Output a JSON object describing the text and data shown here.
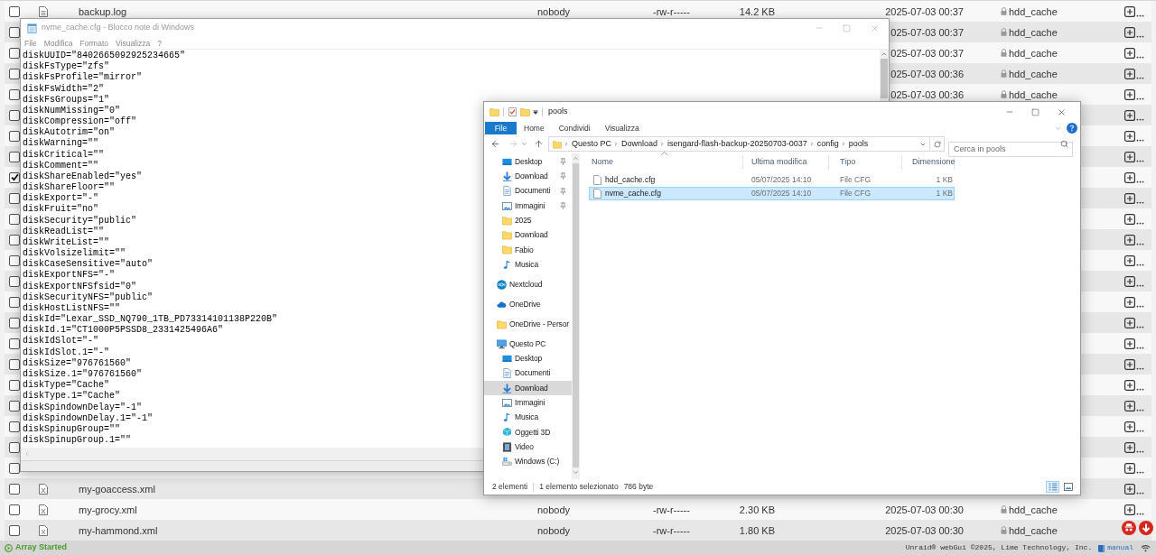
{
  "file_table": {
    "rows": [
      {
        "checked": false,
        "kind": "log",
        "name": "backup.log",
        "owner": "nobody",
        "perms": "-rw-r-----",
        "size": "14.2 KB",
        "modified": "2025-07-03 00:37",
        "share": "hdd_cache",
        "menu_icon": true
      },
      {
        "checked": false,
        "modified": "025-07-03 00:37",
        "share": "hdd_cache",
        "menu_icon": true
      },
      {
        "checked": false,
        "modified": "025-07-03 00:37",
        "share": "hdd_cache",
        "menu_icon": true
      },
      {
        "checked": false,
        "modified": "025-07-03 00:36",
        "share": "hdd_cache",
        "menu_icon": true
      },
      {
        "checked": false,
        "modified": "025-07-03 00:36",
        "share": "hdd_cache",
        "menu_icon": true
      },
      {
        "checked": false,
        "menu_icon": true
      },
      {
        "checked": false,
        "menu_icon": true
      },
      {
        "checked": false,
        "menu_icon": true
      },
      {
        "checked": true,
        "menu_icon": true
      },
      {
        "checked": false,
        "menu_icon": true
      },
      {
        "checked": false,
        "menu_icon": true
      },
      {
        "checked": false,
        "menu_icon": true
      },
      {
        "checked": false,
        "menu_icon": true
      },
      {
        "checked": false,
        "menu_icon": true
      },
      {
        "checked": false,
        "menu_icon": true
      },
      {
        "checked": false,
        "menu_icon": true
      },
      {
        "checked": false,
        "menu_icon": true
      },
      {
        "checked": false,
        "menu_icon": true
      },
      {
        "checked": false,
        "menu_icon": true
      },
      {
        "checked": false,
        "menu_icon": true
      },
      {
        "checked": false,
        "menu_icon": true
      },
      {
        "checked": false,
        "menu_icon": true
      },
      {
        "checked": false,
        "menu_icon": true
      },
      {
        "checked": false,
        "kind": "xml",
        "name": "my-goaccess.xml",
        "menu_icon": true
      },
      {
        "checked": false,
        "kind": "xml",
        "name": "my-grocy.xml",
        "owner": "nobody",
        "perms": "-rw-r-----",
        "size": "2.30 KB",
        "modified": "2025-07-03 00:30",
        "share": "hdd_cache",
        "menu_icon": true
      },
      {
        "checked": false,
        "kind": "xml",
        "name": "my-hammond.xml",
        "owner": "nobody",
        "perms": "-rw-r-----",
        "size": "1.80 KB",
        "modified": "2025-07-03 00:30",
        "share": "hdd_cache",
        "menu_icon": false
      }
    ]
  },
  "notepad": {
    "title": "nvme_cache.cfg - Blocco note di Windows",
    "menu": [
      "File",
      "Modifica",
      "Formato",
      "Visualizza",
      "?"
    ],
    "lines": [
      "diskUUID=\"8402665092925234665\"",
      "diskFsType=\"zfs\"",
      "diskFsProfile=\"mirror\"",
      "diskFsWidth=\"2\"",
      "diskFsGroups=\"1\"",
      "diskNumMissing=\"0\"",
      "diskCompression=\"off\"",
      "diskAutotrim=\"on\"",
      "diskWarning=\"\"",
      "diskCritical=\"\"",
      "diskComment=\"\"",
      "diskShareEnabled=\"yes\"",
      "diskShareFloor=\"\"",
      "diskExport=\"-\"",
      "diskFruit=\"no\"",
      "diskSecurity=\"public\"",
      "diskReadList=\"\"",
      "diskWriteList=\"\"",
      "diskVolsizelimit=\"\"",
      "diskCaseSensitive=\"auto\"",
      "diskExportNFS=\"-\"",
      "diskExportNFSfsid=\"0\"",
      "diskSecurityNFS=\"public\"",
      "diskHostListNFS=\"\"",
      "diskId=\"Lexar_SSD_NQ790_1TB_PD73314101138P220B\"",
      "diskId.1=\"CT1000P5PSSD8_2331425496A6\"",
      "diskIdSlot=\"-\"",
      "diskIdSlot.1=\"-\"",
      "diskSize=\"976761560\"",
      "diskSize.1=\"976761560\"",
      "diskType=\"Cache\"",
      "diskType.1=\"Cache\"",
      "diskSpindownDelay=\"-1\"",
      "diskSpindownDelay.1=\"-1\"",
      "diskSpinupGroup=\"\"",
      "diskSpinupGroup.1=\"\""
    ]
  },
  "explorer": {
    "title": "pools",
    "ribbon": [
      {
        "label": "File",
        "kind": "backstage"
      },
      {
        "label": "Home",
        "kind": "tab"
      },
      {
        "label": "Condividi",
        "kind": "tab"
      },
      {
        "label": "Visualizza",
        "kind": "tab"
      }
    ],
    "breadcrumbs": [
      "Questo PC",
      "Download",
      "isengard-flash-backup-20250703-0037",
      "config",
      "pools"
    ],
    "search": {
      "placeholder": "Cerca in pools"
    },
    "nav_quick": [
      {
        "label": "Desktop",
        "kind": "desktop",
        "pinned": true,
        "selected": false
      },
      {
        "label": "Download",
        "kind": "download",
        "pinned": true,
        "selected": false
      },
      {
        "label": "Documenti",
        "kind": "documents",
        "pinned": true,
        "selected": false
      },
      {
        "label": "Immagini",
        "kind": "pictures",
        "pinned": true,
        "selected": false
      },
      {
        "label": "2025",
        "kind": "folder",
        "pinned": false,
        "selected": false
      },
      {
        "label": "Download",
        "kind": "folder",
        "pinned": false,
        "selected": false
      },
      {
        "label": "Fabio",
        "kind": "folder",
        "pinned": false,
        "selected": false
      },
      {
        "label": "Musica",
        "kind": "music",
        "pinned": false,
        "selected": false
      }
    ],
    "nav_roots": [
      {
        "label": "Nextcloud",
        "kind": "nextcloud",
        "selected": false
      },
      {
        "label": "OneDrive",
        "kind": "onedrive",
        "selected": false
      },
      {
        "label": "OneDrive - Persor",
        "kind": "folder",
        "selected": false
      },
      {
        "label": "Questo PC",
        "kind": "pc",
        "selected": false,
        "children": [
          {
            "label": "Desktop",
            "kind": "desktop",
            "selected": false
          },
          {
            "label": "Documenti",
            "kind": "documents",
            "selected": false
          },
          {
            "label": "Download",
            "kind": "download",
            "selected": true
          },
          {
            "label": "Immagini",
            "kind": "pictures",
            "selected": false
          },
          {
            "label": "Musica",
            "kind": "music",
            "selected": false
          },
          {
            "label": "Oggetti 3D",
            "kind": "objects3d",
            "selected": false
          },
          {
            "label": "Video",
            "kind": "video",
            "selected": false
          },
          {
            "label": "Windows (C:)",
            "kind": "drive",
            "selected": false
          }
        ]
      }
    ],
    "columns": [
      "Nome",
      "Ultima modifica",
      "Tipo",
      "Dimensione"
    ],
    "files": [
      {
        "name": "hdd_cache.cfg",
        "modified": "05/07/2025 14:10",
        "type": "File CFG",
        "size": "1 KB",
        "selected": false
      },
      {
        "name": "nvme_cache.cfg",
        "modified": "05/07/2025 14:10",
        "type": "File CFG",
        "size": "1 KB",
        "selected": true
      }
    ],
    "status": {
      "count": "2 elementi",
      "selection": "1 elemento selezionato",
      "size": "786 byte"
    },
    "views": [
      {
        "kind": "details",
        "selected": true
      },
      {
        "kind": "large_icons",
        "selected": false
      }
    ]
  },
  "status_bar": {
    "array_status": "Array Started",
    "copyright": "Unraid® webGui ©2025, Lime Technology, Inc.",
    "manual": "manual"
  }
}
